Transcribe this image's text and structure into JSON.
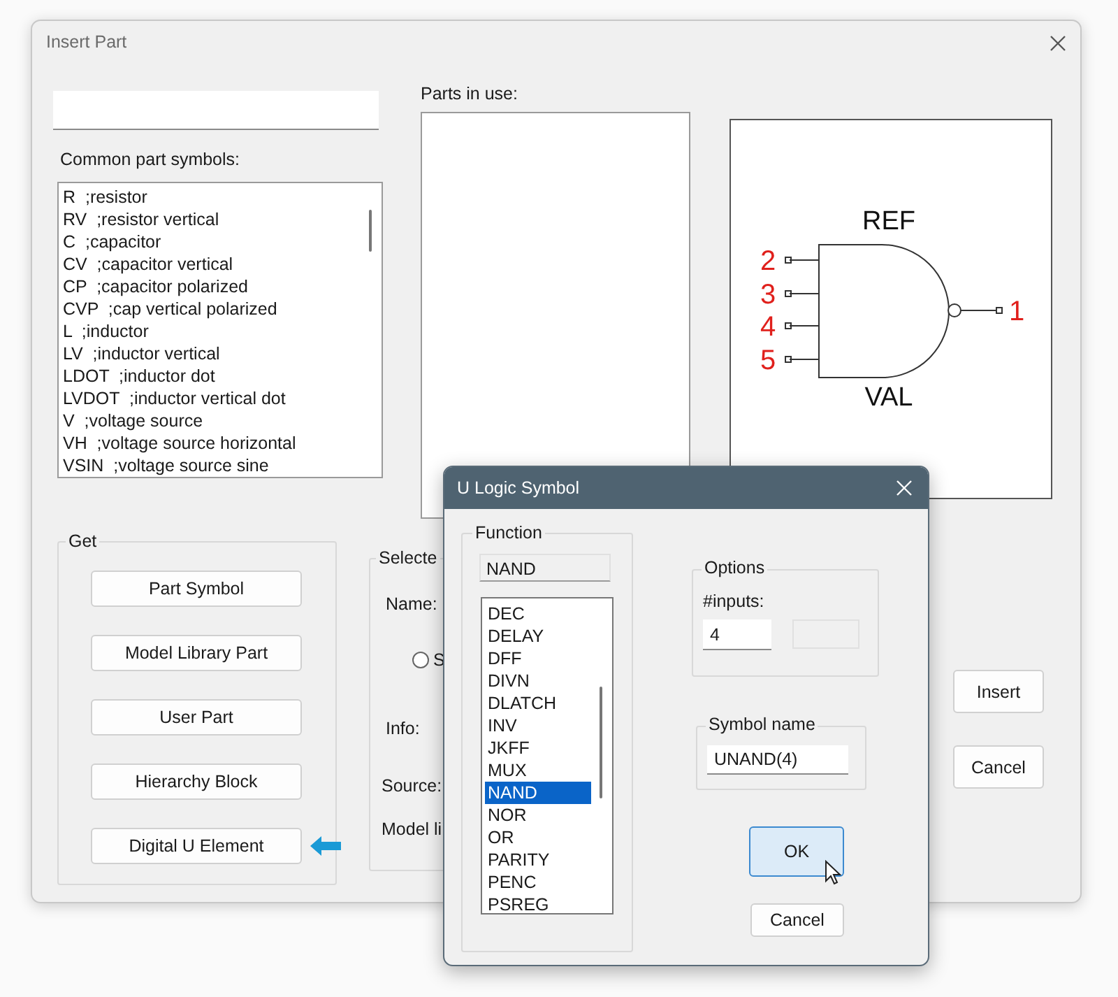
{
  "main_window": {
    "title": "Insert Part",
    "common_parts": {
      "label": "Common part symbols:",
      "items": [
        "R  ;resistor",
        "RV  ;resistor vertical",
        "C  ;capacitor",
        "CV  ;capacitor vertical",
        "CP  ;capacitor polarized",
        "CVP  ;cap vertical polarized",
        "L  ;inductor",
        "LV  ;inductor vertical",
        "LDOT  ;inductor dot",
        "LVDOT  ;inductor vertical dot",
        "V  ;voltage source",
        "VH  ;voltage source horizontal",
        "VSIN  ;voltage source sine"
      ]
    },
    "parts_in_use": {
      "label": "Parts in use:"
    },
    "symbol_preview": {
      "ref": "REF",
      "val": "VAL",
      "input_pins": [
        "2",
        "3",
        "4",
        "5"
      ],
      "output_pin": "1"
    },
    "get_group": {
      "label": "Get",
      "buttons": [
        {
          "label": "Part Symbol",
          "marked": false
        },
        {
          "label": "Model Library Part",
          "marked": false
        },
        {
          "label": "User Part",
          "marked": false
        },
        {
          "label": "Hierarchy Block",
          "marked": false
        },
        {
          "label": "Digital U Element",
          "marked": true
        }
      ]
    },
    "selected_group": {
      "label": "Selecte",
      "name_label": "Name:",
      "radio": {
        "label": "S",
        "selected": false
      },
      "info_label": "Info:",
      "source_label": "Source:",
      "model_label": "Model li"
    },
    "buttons": [
      "Insert",
      "Cancel"
    ]
  },
  "dialog": {
    "title": "U Logic Symbol",
    "function": {
      "label": "Function",
      "value": "NAND",
      "items": [
        {
          "label": "DEC",
          "selected": false
        },
        {
          "label": "DELAY",
          "selected": false
        },
        {
          "label": "DFF",
          "selected": false
        },
        {
          "label": "DIVN",
          "selected": false
        },
        {
          "label": "DLATCH",
          "selected": false
        },
        {
          "label": "INV",
          "selected": false
        },
        {
          "label": "JKFF",
          "selected": false
        },
        {
          "label": "MUX",
          "selected": false
        },
        {
          "label": "NAND",
          "selected": true
        },
        {
          "label": "NOR",
          "selected": false
        },
        {
          "label": "OR",
          "selected": false
        },
        {
          "label": "PARITY",
          "selected": false
        },
        {
          "label": "PENC",
          "selected": false
        },
        {
          "label": "PSREG",
          "selected": false
        }
      ]
    },
    "options": {
      "label": "Options",
      "inputs_label": "#inputs:",
      "inputs_value": "4"
    },
    "symbol_name": {
      "label": "Symbol name",
      "value": "UNAND(4)"
    },
    "buttons": [
      {
        "label": "OK",
        "focused": true
      },
      {
        "label": "Cancel",
        "focused": false
      }
    ]
  }
}
